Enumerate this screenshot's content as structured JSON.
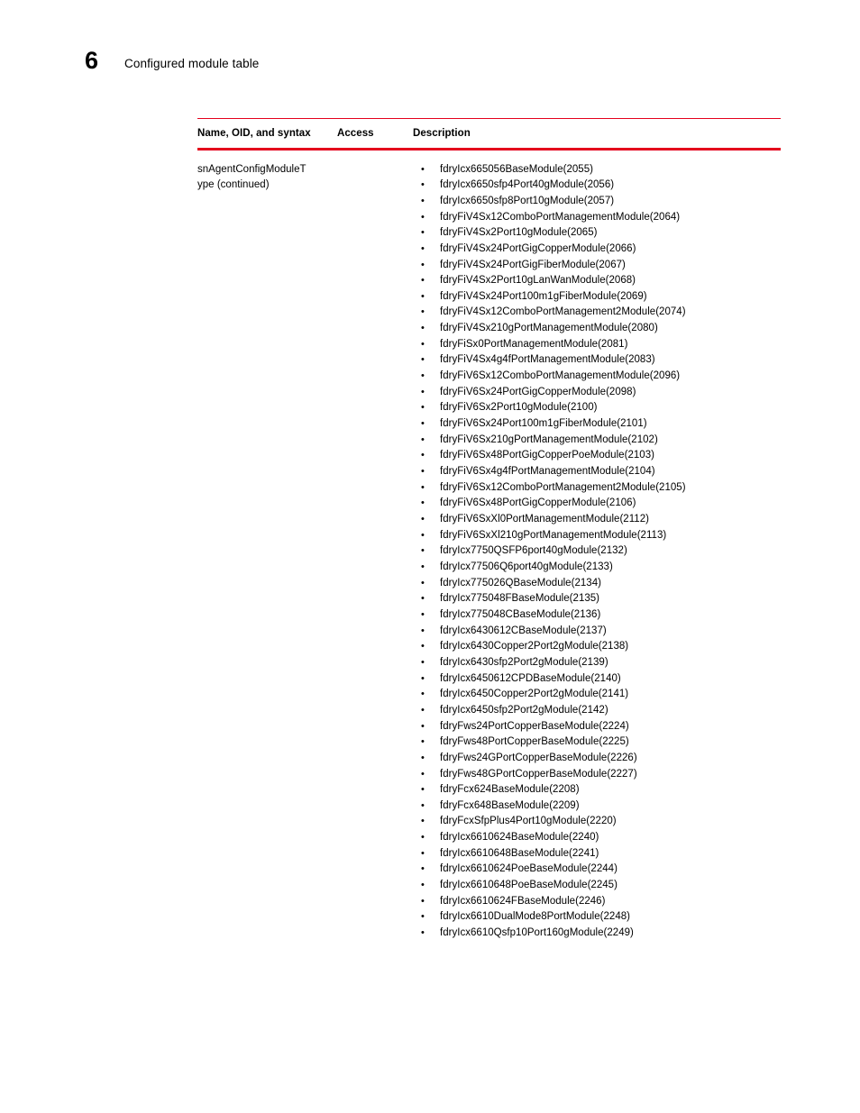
{
  "page": {
    "chapter_number": "6",
    "chapter_title": "Configured module table"
  },
  "table": {
    "accent_color": "#e4001c",
    "headers": {
      "name": "Name, OID, and syntax",
      "access": "Access",
      "description": "Description"
    },
    "row": {
      "name_line1": "snAgentConfigModuleT",
      "name_line2": "ype (continued)",
      "access": "",
      "bullet_glyph": "•",
      "modules": [
        "fdryIcx665056BaseModule(2055)",
        "fdryIcx6650sfp4Port40gModule(2056)",
        "fdryIcx6650sfp8Port10gModule(2057)",
        "fdryFiV4Sx12ComboPortManagementModule(2064)",
        "fdryFiV4Sx2Port10gModule(2065)",
        "fdryFiV4Sx24PortGigCopperModule(2066)",
        "fdryFiV4Sx24PortGigFiberModule(2067)",
        "fdryFiV4Sx2Port10gLanWanModule(2068)",
        "fdryFiV4Sx24Port100m1gFiberModule(2069)",
        "fdryFiV4Sx12ComboPortManagement2Module(2074)",
        "fdryFiV4Sx210gPortManagementModule(2080)",
        "fdryFiSx0PortManagementModule(2081)",
        "fdryFiV4Sx4g4fPortManagementModule(2083)",
        "fdryFiV6Sx12ComboPortManagementModule(2096)",
        "fdryFiV6Sx24PortGigCopperModule(2098)",
        "fdryFiV6Sx2Port10gModule(2100)",
        "fdryFiV6Sx24Port100m1gFiberModule(2101)",
        "fdryFiV6Sx210gPortManagementModule(2102)",
        "fdryFiV6Sx48PortGigCopperPoeModule(2103)",
        "fdryFiV6Sx4g4fPortManagementModule(2104)",
        "fdryFiV6Sx12ComboPortManagement2Module(2105)",
        "fdryFiV6Sx48PortGigCopperModule(2106)",
        "fdryFiV6SxXl0PortManagementModule(2112)",
        "fdryFiV6SxXl210gPortManagementModule(2113)",
        "fdryIcx7750QSFP6port40gModule(2132)",
        "fdryIcx77506Q6port40gModule(2133)",
        "fdryIcx775026QBaseModule(2134)",
        "fdryIcx775048FBaseModule(2135)",
        "fdryIcx775048CBaseModule(2136)",
        "fdryIcx6430612CBaseModule(2137)",
        "fdryIcx6430Copper2Port2gModule(2138)",
        "fdryIcx6430sfp2Port2gModule(2139)",
        "fdryIcx6450612CPDBaseModule(2140)",
        "fdryIcx6450Copper2Port2gModule(2141)",
        "fdryIcx6450sfp2Port2gModule(2142)",
        "fdryFws24PortCopperBaseModule(2224)",
        "fdryFws48PortCopperBaseModule(2225)",
        "fdryFws24GPortCopperBaseModule(2226)",
        "fdryFws48GPortCopperBaseModule(2227)",
        "fdryFcx624BaseModule(2208)",
        "fdryFcx648BaseModule(2209)",
        "fdryFcxSfpPlus4Port10gModule(2220)",
        "fdryIcx6610624BaseModule(2240)",
        "fdryIcx6610648BaseModule(2241)",
        "fdryIcx6610624PoeBaseModule(2244)",
        "fdryIcx6610648PoeBaseModule(2245)",
        "fdryIcx6610624FBaseModule(2246)",
        "fdryIcx6610DualMode8PortModule(2248)",
        "fdryIcx6610Qsfp10Port160gModule(2249)"
      ]
    }
  }
}
